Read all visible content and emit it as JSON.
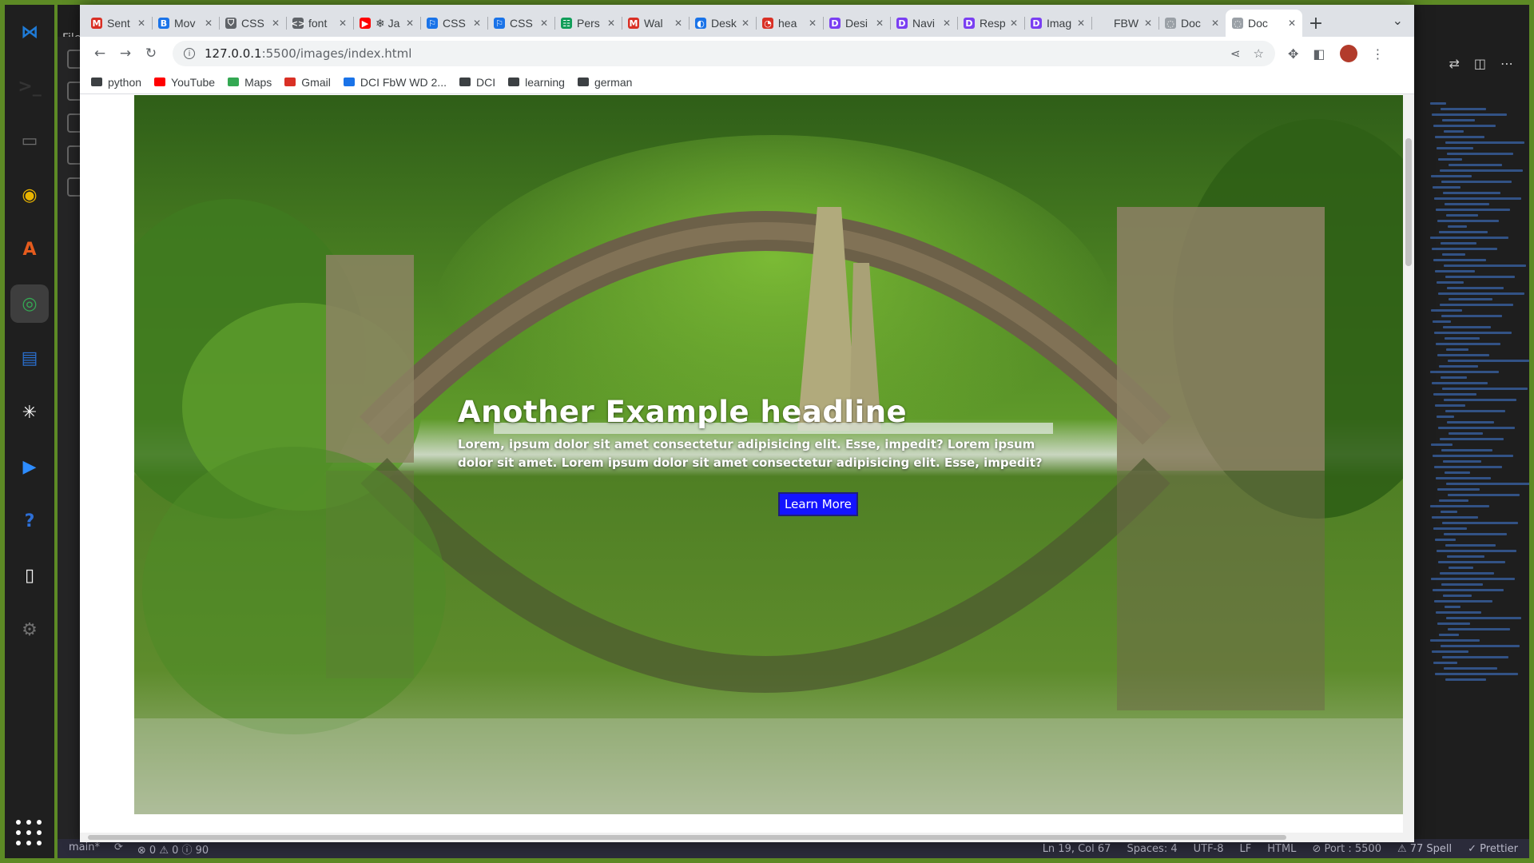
{
  "dock": {
    "items": [
      {
        "name": "vscode-icon",
        "glyph": "⋈",
        "color": "#1f7bd6"
      },
      {
        "name": "terminal-icon",
        "glyph": ">_",
        "color": "#333333"
      },
      {
        "name": "files-icon",
        "glyph": "▭",
        "color": "#6e6e6e"
      },
      {
        "name": "rhythmbox-icon",
        "glyph": "◉",
        "color": "#e9b400"
      },
      {
        "name": "software-icon",
        "glyph": "A",
        "color": "#e55b1d"
      },
      {
        "name": "chrome-icon",
        "glyph": "◎",
        "color": "#34a853"
      },
      {
        "name": "writer-icon",
        "glyph": "▤",
        "color": "#2a6fcf"
      },
      {
        "name": "slack-icon",
        "glyph": "✳",
        "color": "#ffffff"
      },
      {
        "name": "zoom-icon",
        "glyph": "▶",
        "color": "#2d8cff"
      },
      {
        "name": "help-icon",
        "glyph": "?",
        "color": "#2d6fd6"
      },
      {
        "name": "text-editor-icon",
        "glyph": "▯",
        "color": "#f2f2f2"
      },
      {
        "name": "settings-icon",
        "glyph": "⚙",
        "color": "#707070"
      }
    ]
  },
  "vscode": {
    "menu_file": "File",
    "statusbar": {
      "branch": "main*",
      "problems": "⊗ 0 ⚠ 0 ⓘ 90",
      "position": "Ln 19, Col 67",
      "spaces": "Spaces: 4",
      "encoding": "UTF-8",
      "eol": "LF",
      "language": "HTML",
      "port": "⊘ Port : 5500",
      "spell": "⚠ 77 Spell",
      "prettier": "✓ Prettier"
    }
  },
  "chrome": {
    "tabs": [
      {
        "title": "Sent",
        "icon": "M",
        "color": "#d93025"
      },
      {
        "title": "Mov",
        "icon": "B",
        "color": "#1a73e8"
      },
      {
        "title": "CSS",
        "icon": "⛉",
        "color": "#5f6368"
      },
      {
        "title": "font",
        "icon": "<>",
        "color": "#5f6368"
      },
      {
        "title": "❄ Ja",
        "icon": "▶",
        "color": "#ff0000"
      },
      {
        "title": "CSS",
        "icon": "⚐",
        "color": "#1a73e8"
      },
      {
        "title": "CSS",
        "icon": "⚐",
        "color": "#1a73e8"
      },
      {
        "title": "Pers",
        "icon": "☷",
        "color": "#0f9d58"
      },
      {
        "title": "Wal",
        "icon": "M",
        "color": "#d93025"
      },
      {
        "title": "Desk",
        "icon": "◐",
        "color": "#1a73e8"
      },
      {
        "title": "hea",
        "icon": "◔",
        "color": "#d93025"
      },
      {
        "title": "Desi",
        "icon": "D",
        "color": "#7a3ff2"
      },
      {
        "title": "Navi",
        "icon": "D",
        "color": "#7a3ff2"
      },
      {
        "title": "Resp",
        "icon": "D",
        "color": "#7a3ff2"
      },
      {
        "title": "Imag",
        "icon": "D",
        "color": "#7a3ff2"
      },
      {
        "title": "FBW",
        "icon": "",
        "color": "#dee1e6"
      },
      {
        "title": "Doc",
        "icon": "◌",
        "color": "#9aa0a6"
      },
      {
        "title": "Doc",
        "icon": "◌",
        "color": "#9aa0a6",
        "active": true
      }
    ],
    "url_host": "127.0.0.1",
    "url_path": ":5500/images/index.html",
    "bookmarks": [
      {
        "label": "python",
        "color": "#3c4043"
      },
      {
        "label": "YouTube",
        "color": "#ff0000"
      },
      {
        "label": "Maps",
        "color": "#34a853"
      },
      {
        "label": "Gmail",
        "color": "#d93025"
      },
      {
        "label": "DCI FbW WD 2...",
        "color": "#1a73e8"
      },
      {
        "label": "DCI",
        "color": "#3c4043"
      },
      {
        "label": "learning",
        "color": "#3c4043"
      },
      {
        "label": "german",
        "color": "#3c4043"
      }
    ]
  },
  "page": {
    "headline": "Another Example headline",
    "body": "Lorem, ipsum dolor sit amet consectetur adipisicing elit. Esse, impedit? Lorem ipsum dolor sit amet. Lorem ipsum dolor sit amet consectetur adipisicing elit. Esse, impedit?",
    "button": "Learn More",
    "button_color": "#1414ff"
  }
}
